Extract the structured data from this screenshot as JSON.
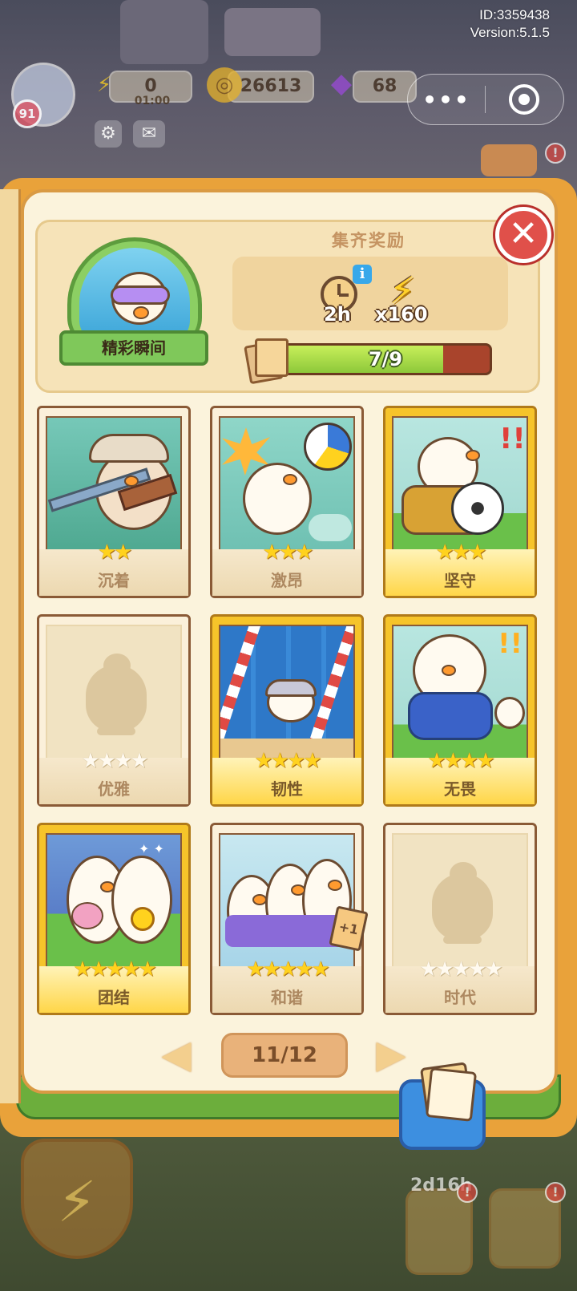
{
  "app": {
    "id_text": "ID:3359438",
    "version_text": "Version:5.1.5"
  },
  "top_bar": {
    "level": "91",
    "energy_value": "0",
    "energy_timer": "01:00",
    "coins_value": "26613",
    "gems_value": "68"
  },
  "collection": {
    "album_title": "精彩瞬间",
    "reward_title": "集齐奖励",
    "rewards": [
      {
        "icon": "clock-icon",
        "amount": "2h"
      },
      {
        "icon": "bolt-icon",
        "amount": "x160"
      }
    ],
    "progress_text": "7/9",
    "progress_fraction": 0.778
  },
  "cards": [
    {
      "name": "沉着",
      "stars": 2,
      "max_stars": 2,
      "rarity": "normal",
      "collected": true
    },
    {
      "name": "激昂",
      "stars": 3,
      "max_stars": 3,
      "rarity": "normal",
      "collected": true
    },
    {
      "name": "坚守",
      "stars": 3,
      "max_stars": 3,
      "rarity": "gold",
      "collected": true
    },
    {
      "name": "优雅",
      "stars": 0,
      "max_stars": 4,
      "rarity": "normal",
      "collected": false
    },
    {
      "name": "韧性",
      "stars": 4,
      "max_stars": 4,
      "rarity": "gold",
      "collected": true
    },
    {
      "name": "无畏",
      "stars": 4,
      "max_stars": 4,
      "rarity": "gold",
      "collected": true
    },
    {
      "name": "团结",
      "stars": 5,
      "max_stars": 5,
      "rarity": "gold",
      "collected": true
    },
    {
      "name": "和谐",
      "stars": 5,
      "max_stars": 5,
      "rarity": "normal",
      "collected": true,
      "extra": "+1"
    },
    {
      "name": "时代",
      "stars": 0,
      "max_stars": 5,
      "rarity": "normal",
      "collected": false
    }
  ],
  "pager": {
    "label": "11/12"
  },
  "bottom": {
    "timer_text": "2d16h"
  },
  "colors": {
    "accent_gold": "#f6c42a",
    "progress_green": "#8dc83a",
    "progress_track": "#a9442c",
    "close_red": "#e0504a"
  }
}
